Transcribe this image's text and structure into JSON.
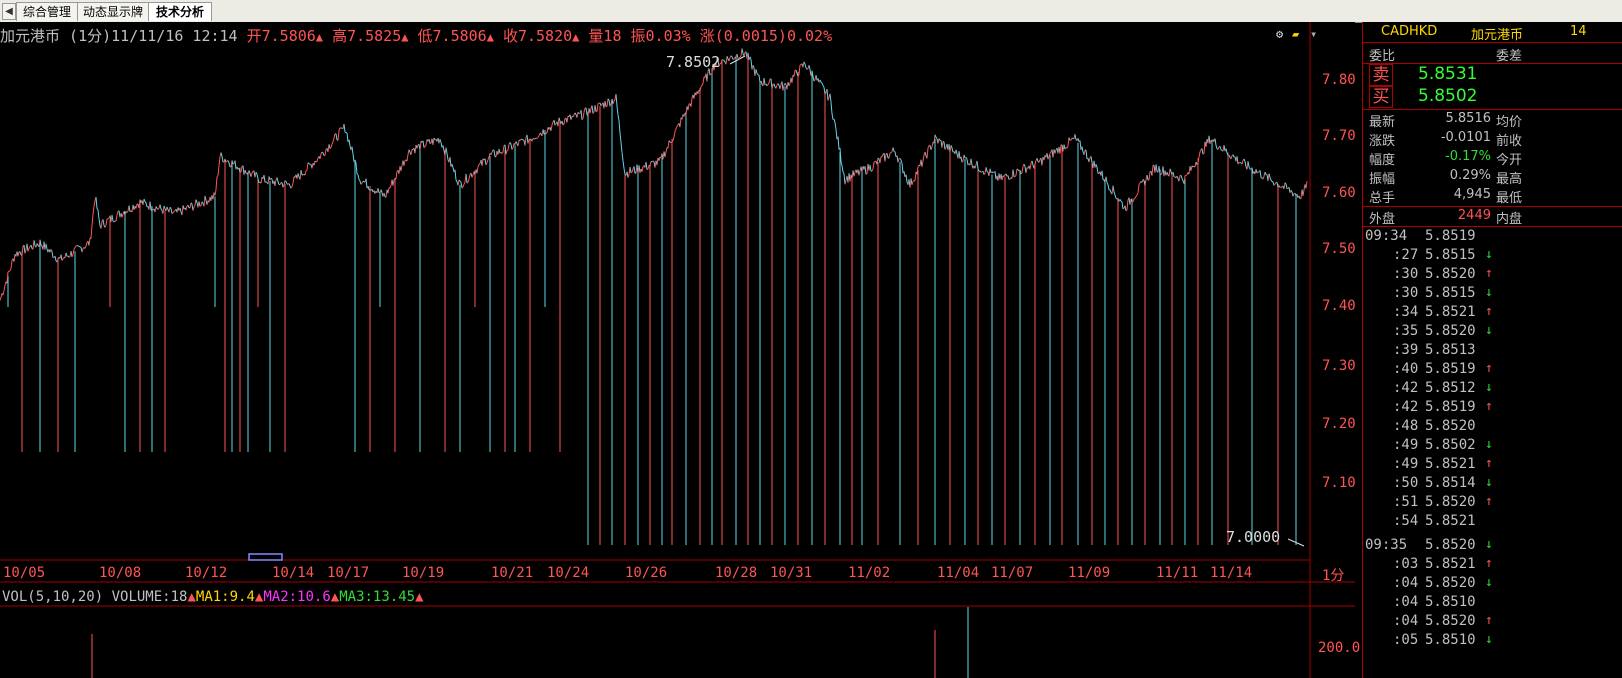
{
  "tabs": [
    "综合管理",
    "动态显示牌",
    "技术分析"
  ],
  "tab_arrow": "◀",
  "info_bar": {
    "name": "加元港币",
    "period": "(1分)",
    "datetime": "11/11/16 12:14",
    "open": "开7.5806",
    "high": "高7.5825",
    "low": "低7.5806",
    "close": "收7.5820",
    "volume": "量18",
    "amplitude": "振0.03%",
    "change": "涨(0.0015)0.02%",
    "tri": "▲"
  },
  "price_axis": [
    "7.80",
    "7.70",
    "7.60",
    "7.50",
    "7.40",
    "7.30",
    "7.20",
    "7.10"
  ],
  "time_axis": [
    "10/05",
    "10/08",
    "10/12",
    "10/14",
    "10/17",
    "10/19",
    "10/21",
    "10/24",
    "10/26",
    "10/28",
    "10/31",
    "11/02",
    "11/04",
    "11/07",
    "11/09",
    "11/11",
    "11/14"
  ],
  "period_label": "1分",
  "max_label": "7.8502",
  "min_label": "7.0000",
  "vol_bar": {
    "title": "VOL(5,10,20)",
    "volume": "VOLUME:18",
    "ma1": "MA1:9.4",
    "ma2": "MA2:10.6",
    "ma3": "MA3:13.45"
  },
  "vol_axis": "200.0",
  "panel": {
    "code": "CADHKD",
    "name": "加元港币",
    "num": "14",
    "weibi": "委比",
    "weicha": "委差",
    "sell_label": "卖",
    "sell_value": "5.8531",
    "buy_label": "买",
    "buy_value": "5.8502",
    "stats": [
      {
        "l": "最新",
        "v": "5.8516",
        "r": "均价",
        "c": "#c0c0c0"
      },
      {
        "l": "涨跌",
        "v": "-0.0101",
        "r": "前收",
        "c": "#c0c0c0"
      },
      {
        "l": "幅度",
        "v": "-0.17%",
        "r": "今开",
        "c": "#33dd33"
      },
      {
        "l": "振幅",
        "v": "0.29%",
        "r": "最高",
        "c": "#c0c0c0"
      },
      {
        "l": "总手",
        "v": "4,945",
        "r": "最低",
        "c": "#c0c0c0"
      }
    ],
    "outer_label": "外盘",
    "outer_value": "2449",
    "inner_label": "内盘",
    "ticks": [
      {
        "t": "09:34",
        "p": "5.8519",
        "d": ""
      },
      {
        "t": ":27",
        "p": "5.8515",
        "d": "down"
      },
      {
        "t": ":30",
        "p": "5.8520",
        "d": "up"
      },
      {
        "t": ":30",
        "p": "5.8515",
        "d": "down"
      },
      {
        "t": ":34",
        "p": "5.8521",
        "d": "up"
      },
      {
        "t": ":35",
        "p": "5.8520",
        "d": "down"
      },
      {
        "t": ":39",
        "p": "5.8513",
        "d": ""
      },
      {
        "t": ":40",
        "p": "5.8519",
        "d": "up"
      },
      {
        "t": ":42",
        "p": "5.8512",
        "d": "down"
      },
      {
        "t": ":42",
        "p": "5.8519",
        "d": "up"
      },
      {
        "t": ":48",
        "p": "5.8520",
        "d": ""
      },
      {
        "t": ":49",
        "p": "5.8502",
        "d": "down"
      },
      {
        "t": ":49",
        "p": "5.8521",
        "d": "up"
      },
      {
        "t": ":50",
        "p": "5.8514",
        "d": "down"
      },
      {
        "t": ":51",
        "p": "5.8520",
        "d": "up"
      },
      {
        "t": ":54",
        "p": "5.8521",
        "d": ""
      },
      {
        "t": "09:35",
        "p": "5.8520",
        "d": "down"
      },
      {
        "t": ":03",
        "p": "5.8521",
        "d": "up"
      },
      {
        "t": ":04",
        "p": "5.8520",
        "d": "down"
      },
      {
        "t": ":04",
        "p": "5.8510",
        "d": ""
      },
      {
        "t": ":04",
        "p": "5.8520",
        "d": "up"
      },
      {
        "t": ":05",
        "p": "5.8510",
        "d": "down"
      }
    ]
  },
  "colors": {
    "up": "#ff5454",
    "down": "#33dd33",
    "axis": "#a00000"
  }
}
